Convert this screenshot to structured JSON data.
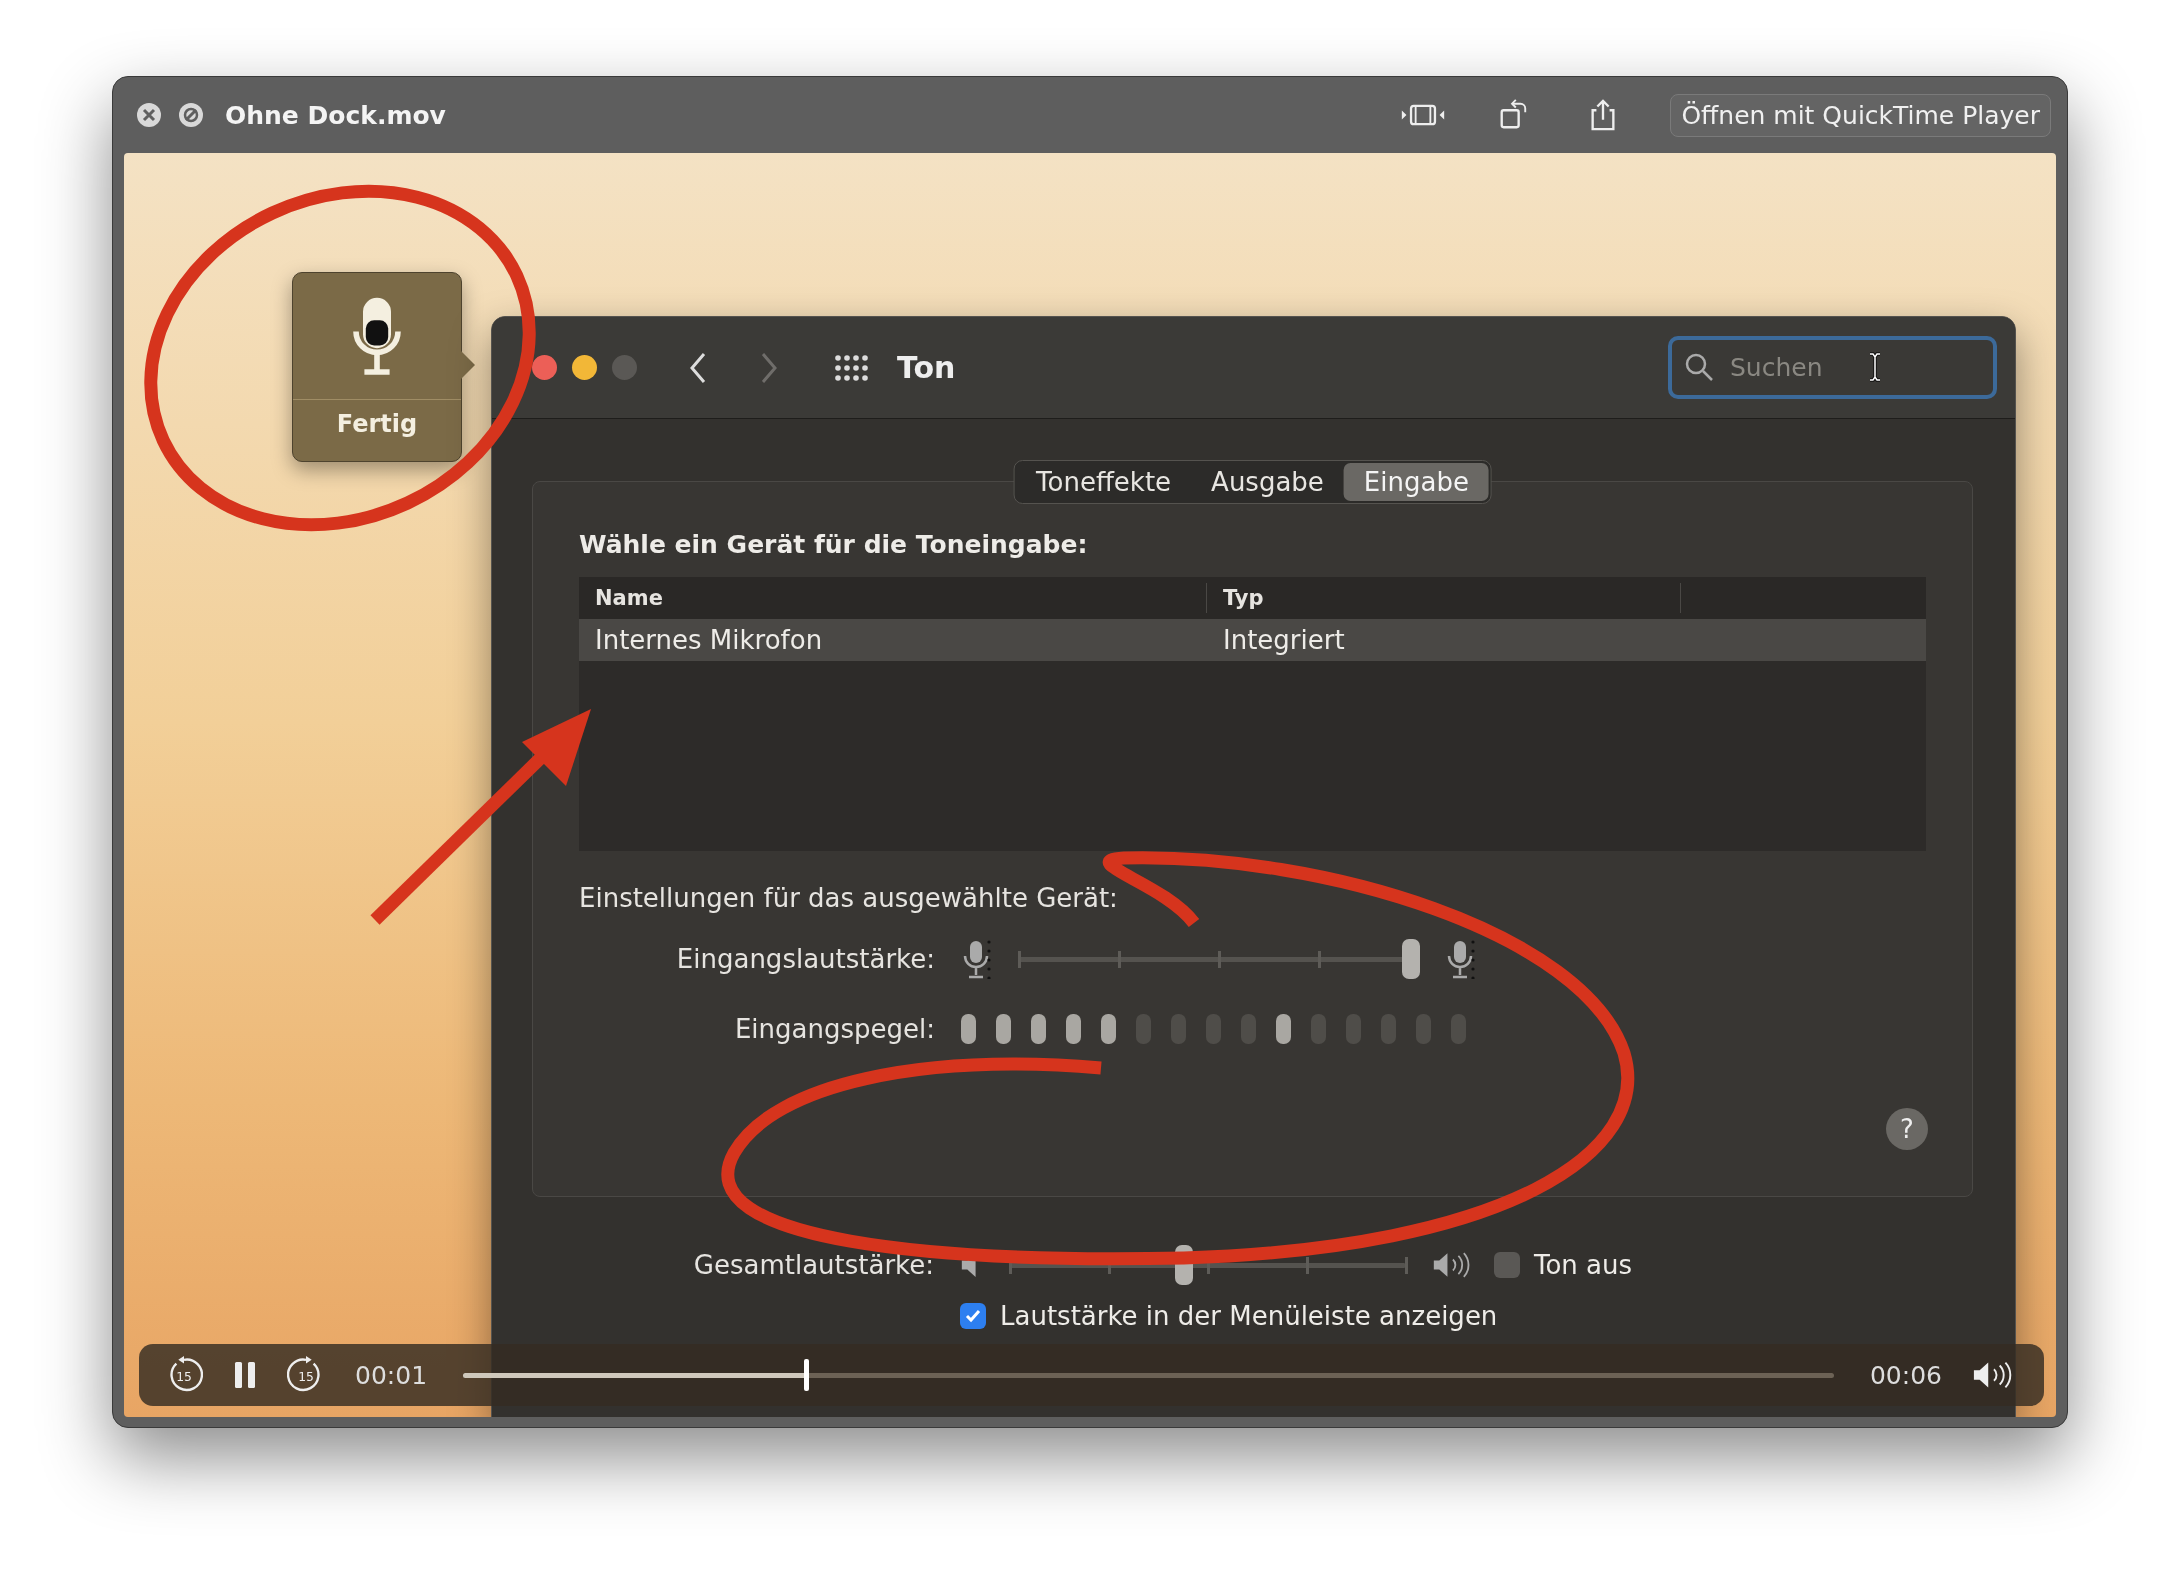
{
  "window": {
    "title": "Ohne Dock.mov",
    "open_button": "Öffnen mit QuickTime Player"
  },
  "hud": {
    "label": "Fertig"
  },
  "prefs": {
    "title": "Ton",
    "search": {
      "placeholder": "Suchen"
    },
    "tabs": [
      {
        "label": "Toneffekte",
        "selected": false
      },
      {
        "label": "Ausgabe",
        "selected": false
      },
      {
        "label": "Eingabe",
        "selected": true
      }
    ],
    "device_heading": "Wähle ein Gerät für die Toneingabe:",
    "table": {
      "columns": [
        "Name",
        "Typ"
      ],
      "rows": [
        {
          "cells": [
            "Internes Mikrofon",
            "Integriert"
          ],
          "selected": true
        }
      ]
    },
    "settings_heading": "Einstellungen für das ausgewählte Gerät:",
    "input_volume": {
      "label": "Eingangslautstärke:",
      "level": 0.98
    },
    "input_level": {
      "label": "Eingangspegel:",
      "segments": [
        {
          "lit": true
        },
        {
          "lit": true
        },
        {
          "lit": true
        },
        {
          "lit": true
        },
        {
          "lit": true
        },
        {
          "lit": false
        },
        {
          "lit": false
        },
        {
          "lit": false
        },
        {
          "lit": false
        },
        {
          "lit": true
        },
        {
          "lit": false
        },
        {
          "lit": false
        },
        {
          "lit": false
        },
        {
          "lit": false
        },
        {
          "lit": false
        }
      ]
    },
    "help": "?",
    "output_volume": {
      "label": "Gesamtlautstärke:",
      "level": 0.44
    },
    "mute": {
      "label": "Ton aus",
      "checked": false
    },
    "menubar": {
      "label": "Lautstärke in der Menüleiste anzeigen",
      "checked": true
    }
  },
  "player": {
    "skip_back": "15",
    "skip_forward": "15",
    "elapsed": "00:01",
    "remaining": "00:06",
    "level": 0.25
  }
}
